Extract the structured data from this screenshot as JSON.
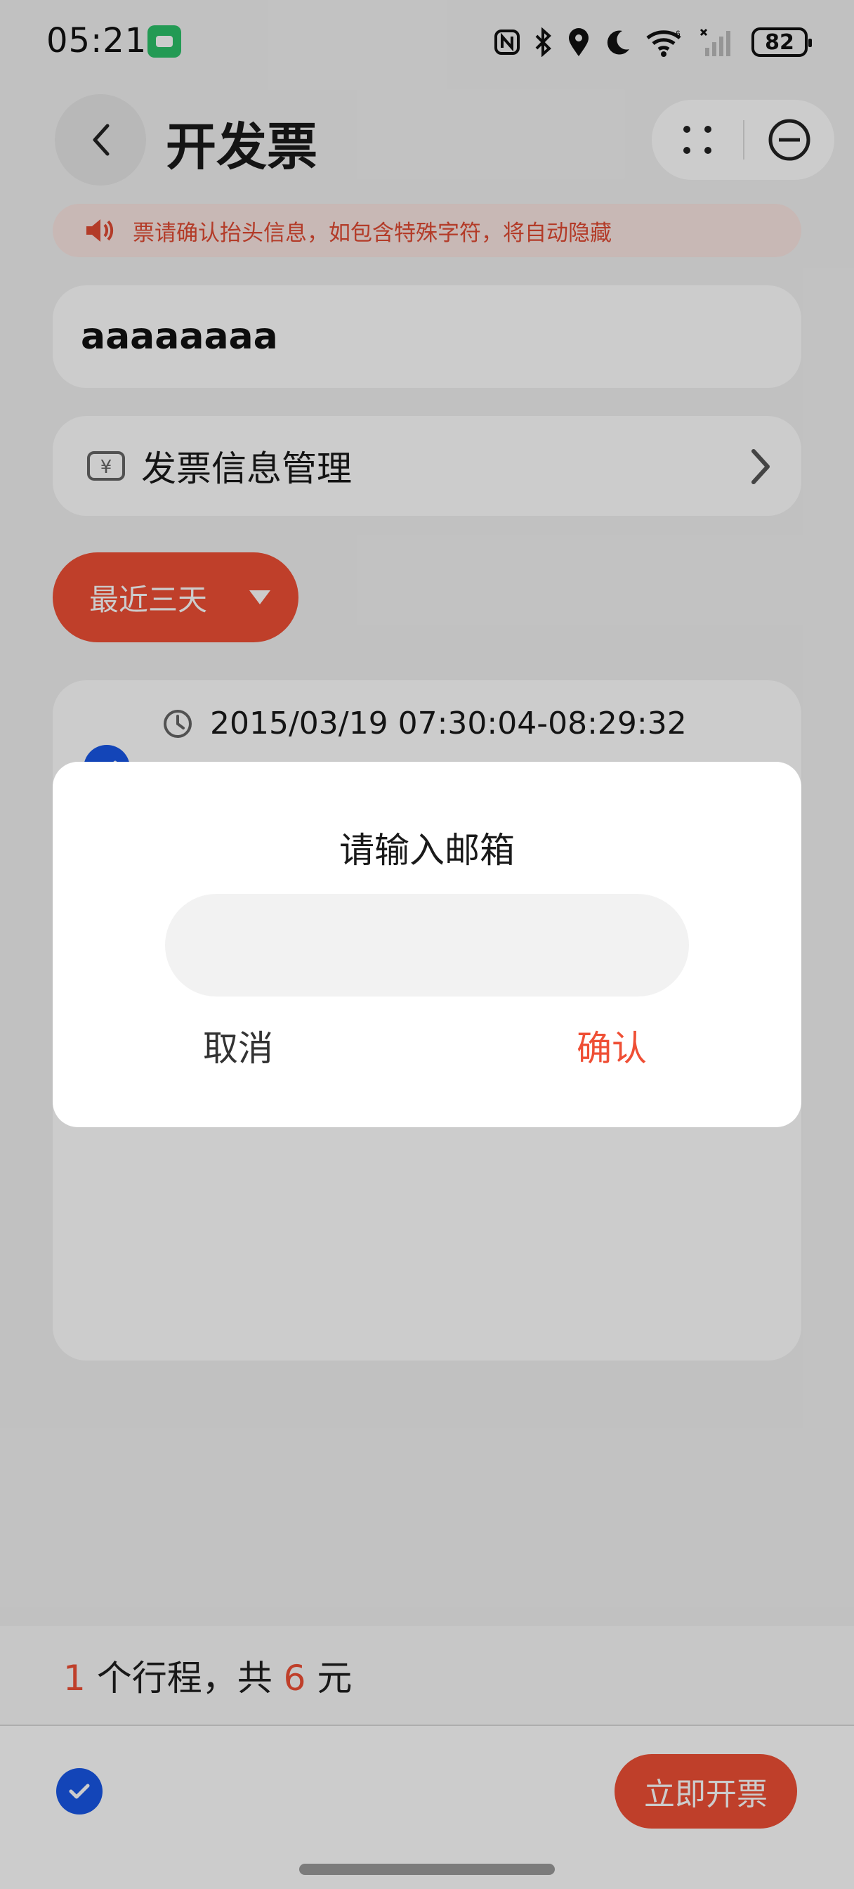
{
  "status_bar": {
    "time": "05:21",
    "battery": "82",
    "icons": [
      "nfc-icon",
      "bluetooth-icon",
      "location-icon",
      "moon-icon",
      "wifi-icon",
      "signal-icon"
    ]
  },
  "header": {
    "title": "开发票"
  },
  "notice": {
    "text": "票请确认抬头信息，如包含特殊字符，将自动隐藏"
  },
  "invoice_title": {
    "value": "aaaaaaaa"
  },
  "invoice_info": {
    "label": "发票信息管理"
  },
  "filter": {
    "range_label": "最近三天"
  },
  "trip": {
    "time_range": "2015/03/19 07:30:04-08:29:32"
  },
  "summary": {
    "count": "1",
    "count_suffix": " 个行程，共 ",
    "amount": "6",
    "amount_suffix": " 元"
  },
  "actions": {
    "issue_label": "立即开票"
  },
  "dialog": {
    "title": "请输入邮箱",
    "email_value": "",
    "cancel_label": "取消",
    "confirm_label": "确认"
  },
  "colors": {
    "accent": "#ef4f35",
    "check_blue": "#1857e6",
    "notice_bg": "#fbe6e3"
  }
}
